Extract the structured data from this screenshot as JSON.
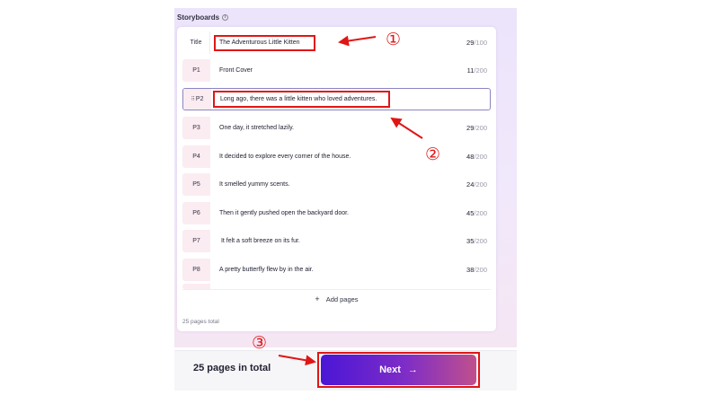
{
  "storyboards": {
    "title": "Storyboards",
    "info_icon": "info-icon",
    "rows": [
      {
        "label": "Title",
        "text": "The Adventurous Little Kitten",
        "count": "29",
        "max": "100"
      },
      {
        "label": "P1",
        "text": "Front Cover",
        "count": "11",
        "max": "200"
      },
      {
        "label": "P2",
        "text": "Long ago, there was a little kitten who loved adventures.",
        "count": "",
        "max": "",
        "selected": true
      },
      {
        "label": "P3",
        "text": "One day, it stretched lazily.",
        "count": "29",
        "max": "200"
      },
      {
        "label": "P4",
        "text": "It decided to explore every corner of the house.",
        "count": "48",
        "max": "200"
      },
      {
        "label": "P5",
        "text": "It smelled yummy scents.",
        "count": "24",
        "max": "200"
      },
      {
        "label": "P6",
        "text": "Then it gently pushed open the backyard door.",
        "count": "45",
        "max": "200"
      },
      {
        "label": "P7",
        "text": " It felt a soft breeze on its fur.",
        "count": "35",
        "max": "200"
      },
      {
        "label": "P8",
        "text": "A pretty butterfly flew by in the air.",
        "count": "38",
        "max": "200"
      }
    ],
    "add_pages_label": "Add pages",
    "pages_total_small": "25 pages total"
  },
  "footer": {
    "pages_total": "25 pages in total",
    "next_label": "Next"
  },
  "annotations": {
    "color": "#e01616",
    "numbers": [
      "①",
      "②",
      "③"
    ]
  },
  "colors": {
    "accent_start": "#4a16d6",
    "accent_end": "#c0508c",
    "label_bg": "#fbecf2"
  }
}
